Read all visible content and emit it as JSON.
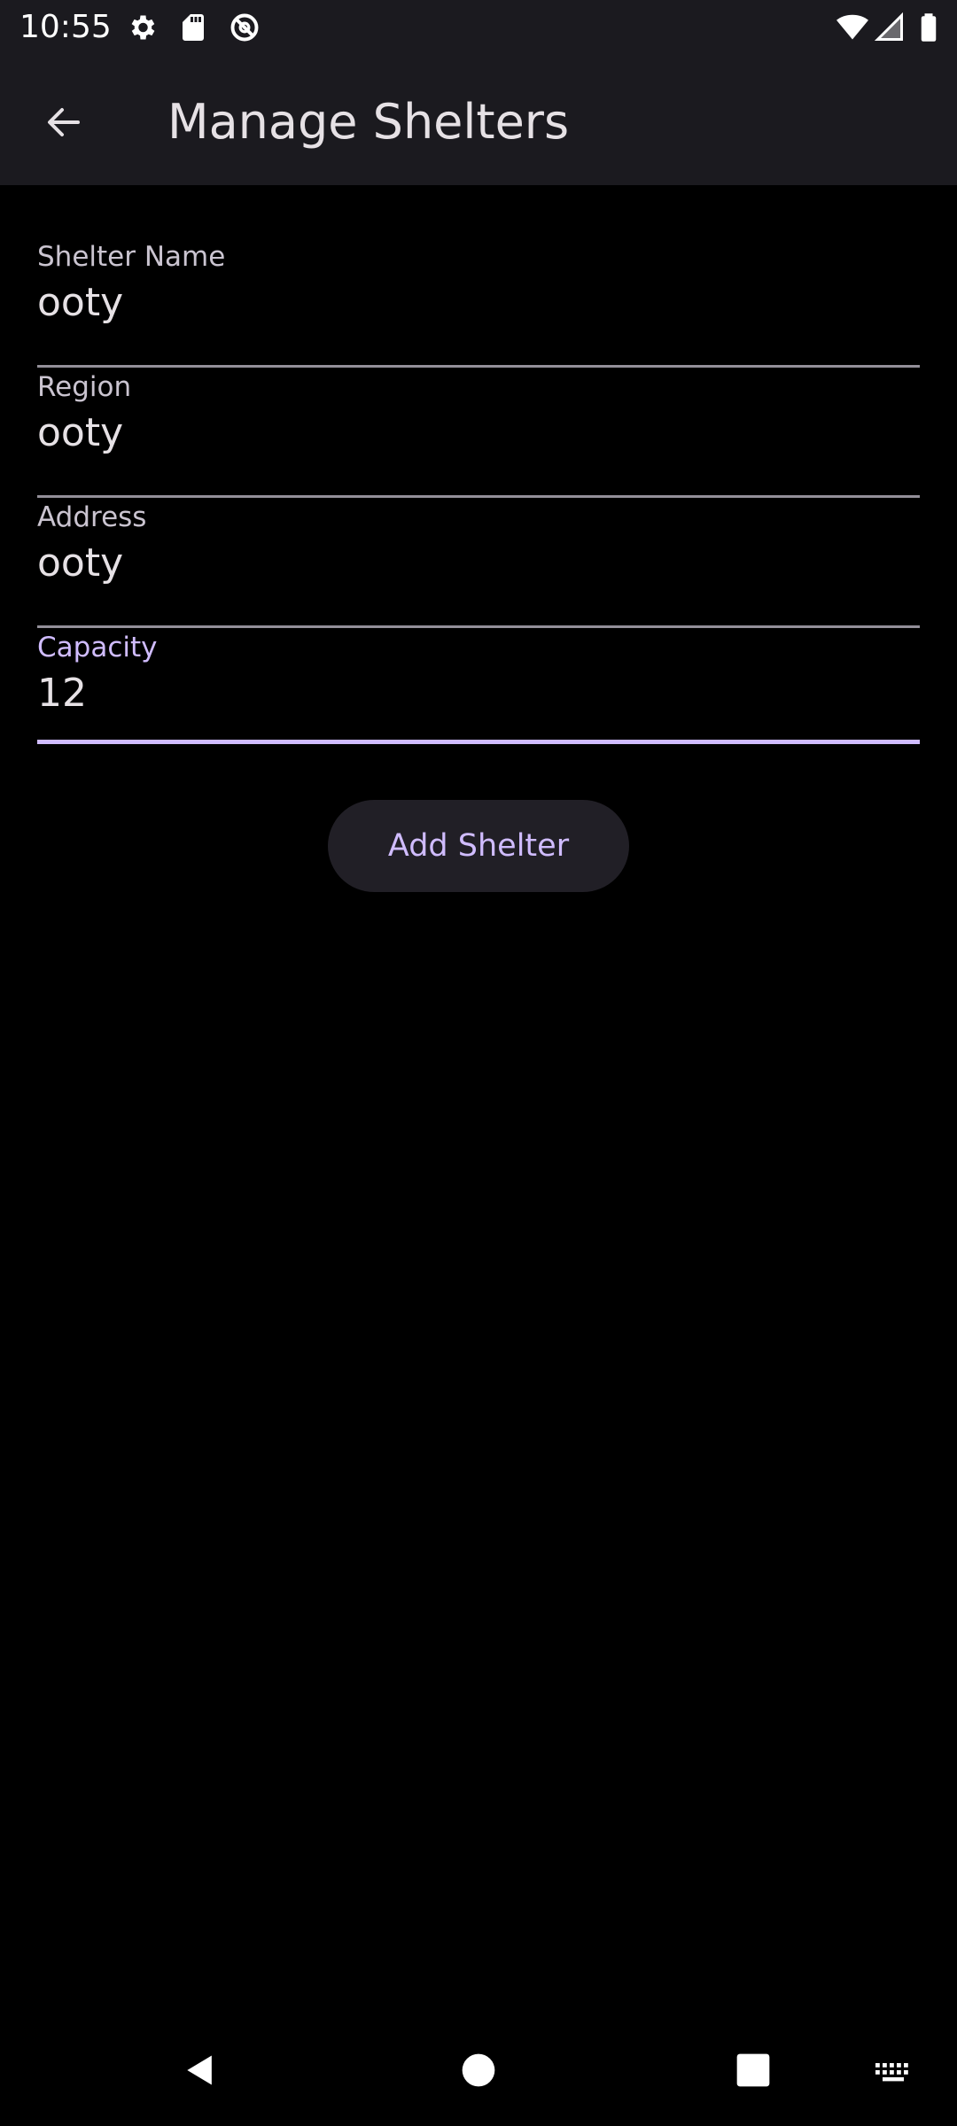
{
  "status_bar": {
    "time": "10:55",
    "icons": [
      "settings-icon",
      "sd-card-icon",
      "data-saver-icon",
      "wifi-icon",
      "signal-icon",
      "battery-icon"
    ]
  },
  "app_bar": {
    "title": "Manage Shelters",
    "back_icon": "arrow-back-icon"
  },
  "form": {
    "fields": [
      {
        "label": "Shelter Name",
        "value": "ooty"
      },
      {
        "label": "Region",
        "value": "ooty"
      },
      {
        "label": "Address",
        "value": "ooty"
      },
      {
        "label": "Capacity",
        "value": "12"
      }
    ],
    "submit_label": "Add Shelter"
  },
  "nav_bar": {
    "items": [
      "back-icon",
      "home-icon",
      "recents-icon",
      "keyboard-icon"
    ]
  },
  "colors": {
    "background": "#000000",
    "app_bar": "#1b1a1f",
    "accent": "#d0bcff",
    "text": "#e6e1e5",
    "label": "#cac4d0",
    "underline": "#938f99",
    "button_bg": "#211f26"
  }
}
